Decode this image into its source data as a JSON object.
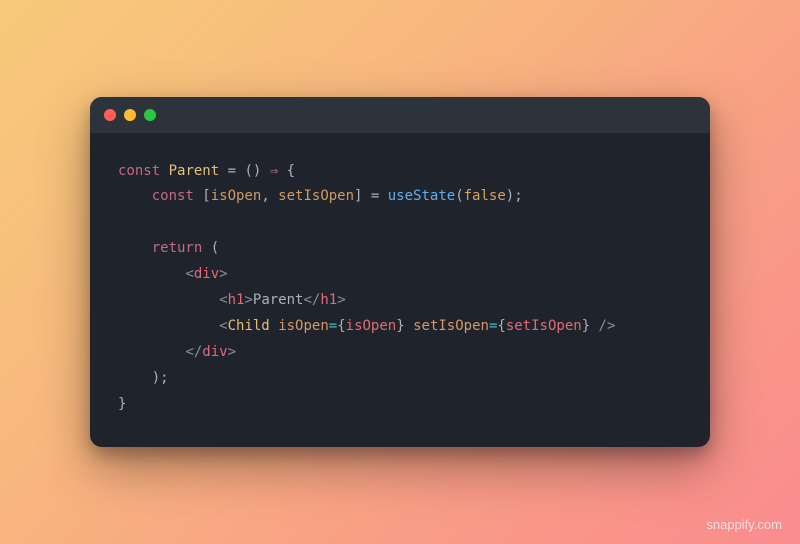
{
  "titlebar": {
    "buttons": [
      "close",
      "minimize",
      "maximize"
    ]
  },
  "code": {
    "l1": {
      "const": "const",
      "Parent": "Parent",
      "eq": " = () ",
      "arrow": "⇒",
      "brace": " {"
    },
    "l2": {
      "const": "const",
      "open": " [",
      "isOpen": "isOpen",
      "c1": ", ",
      "setIsOpen": "setIsOpen",
      "close": "] = ",
      "useState": "useState",
      "p1": "(",
      "false": "false",
      "p2": ");"
    },
    "l3": {
      "return": "return",
      "p": " ("
    },
    "l4": {
      "lt": "<",
      "div": "div",
      "gt": ">"
    },
    "l5": {
      "lt": "<",
      "h1": "h1",
      "gt": ">",
      "text": "Parent",
      "lt2": "</",
      "h1b": "h1",
      "gt2": ">"
    },
    "l6": {
      "lt": "<",
      "Child": "Child",
      "sp": " ",
      "a1": "isOpen",
      "eq1": "=",
      "b1": "{",
      "v1": "isOpen",
      "b2": "}",
      "sp2": " ",
      "a2": "setIsOpen",
      "eq2": "=",
      "b3": "{",
      "v2": "setIsOpen",
      "b4": "}",
      "end": " />"
    },
    "l7": {
      "lt": "</",
      "div": "div",
      "gt": ">"
    },
    "l8": {
      "p": ");"
    },
    "l9": {
      "b": "}"
    }
  },
  "watermark": "snappify.com"
}
